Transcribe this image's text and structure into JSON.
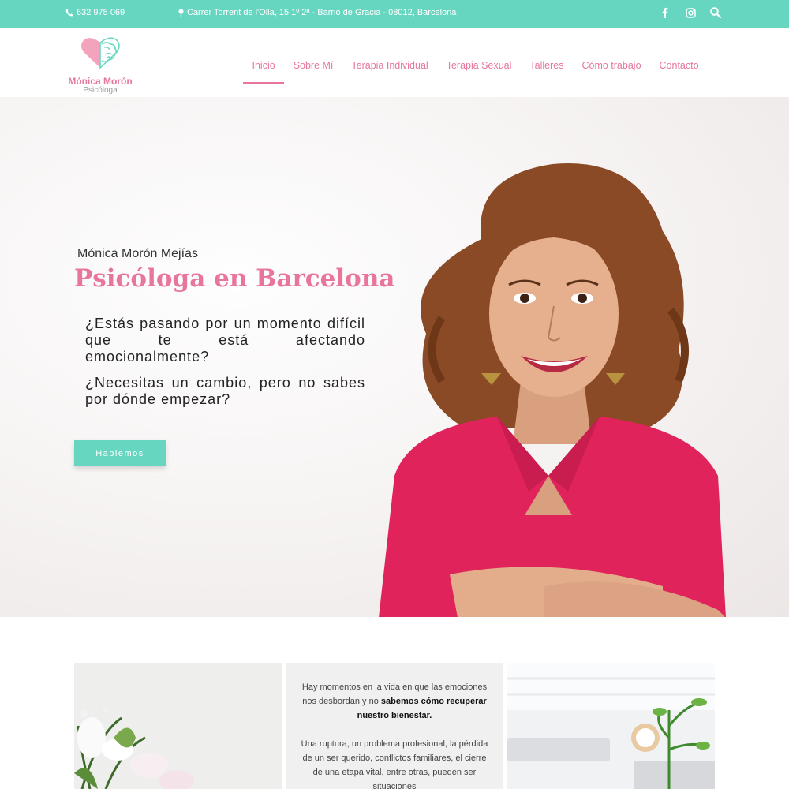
{
  "topbar": {
    "phone": "632 975 069",
    "address": "Carrer Torrent de l'Olla, 15 1º 2ª - Barrio de Gracia - 08012, Barcelona",
    "icons": [
      "facebook-icon",
      "instagram-icon",
      "search-icon"
    ]
  },
  "logo": {
    "brand": "Mónica Morón",
    "subtitle": "Psicóloga"
  },
  "nav": {
    "items": [
      {
        "label": "Inicio",
        "active": true
      },
      {
        "label": "Sobre Mí"
      },
      {
        "label": "Terapia Individual"
      },
      {
        "label": "Terapia Sexual"
      },
      {
        "label": "Talleres"
      },
      {
        "label": "Cómo trabajo"
      },
      {
        "label": "Contacto"
      }
    ]
  },
  "hero": {
    "name": "Mónica Morón Mejías",
    "title": "Psicóloga en Barcelona",
    "question1": "¿Estás pasando por un momento difícil que te está afectando emocionalmente?",
    "question2": "¿Necesitas un cambio, pero no sabes por dónde empezar?",
    "cta": "Hablemos"
  },
  "intro": {
    "p1_start": "Hay momentos en la vida en que las emociones nos desbordan y no ",
    "p1_bold": "sabemos cómo recuperar nuestro bienestar.",
    "p2": "Una ruptura, un problema profesional, la pérdida de un ser querido, conflictos familiares, el cierre de una etapa vital, entre otras, pueden ser situaciones"
  },
  "colors": {
    "accent_teal": "#66d6c1",
    "accent_pink": "#e8769b",
    "blouse": "#e0245b"
  }
}
